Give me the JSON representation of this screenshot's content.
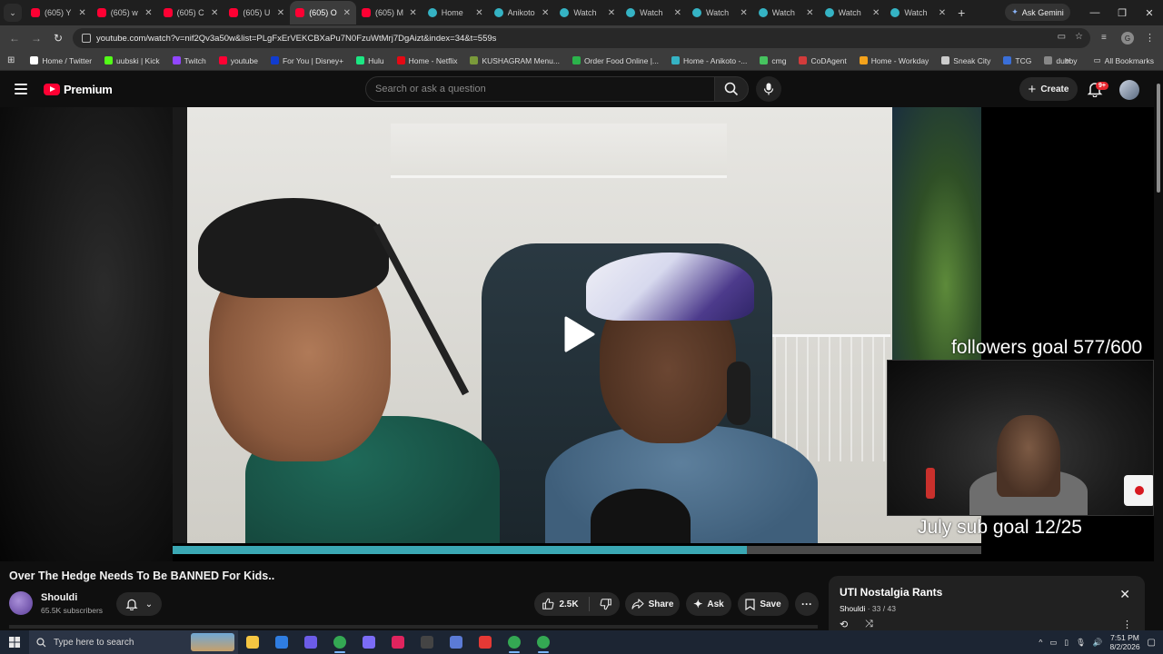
{
  "browser": {
    "tabs": [
      {
        "label": "(605) Y",
        "fav": "yt",
        "active": false
      },
      {
        "label": "(605) w",
        "fav": "yt",
        "active": false
      },
      {
        "label": "(605) C",
        "fav": "yt",
        "active": false
      },
      {
        "label": "(605) U",
        "fav": "yt",
        "active": false
      },
      {
        "label": "(605) O",
        "fav": "yt",
        "active": true
      },
      {
        "label": "(605) M",
        "fav": "yt",
        "active": false
      },
      {
        "label": "Home",
        "fav": "ani",
        "active": false
      },
      {
        "label": "Anikoto",
        "fav": "ani",
        "active": false
      },
      {
        "label": "Watch",
        "fav": "ani",
        "active": false
      },
      {
        "label": "Watch",
        "fav": "ani",
        "active": false
      },
      {
        "label": "Watch",
        "fav": "ani",
        "active": false
      },
      {
        "label": "Watch",
        "fav": "ani",
        "active": false
      },
      {
        "label": "Watch",
        "fav": "ani",
        "active": false
      },
      {
        "label": "Watch",
        "fav": "ani",
        "active": false
      }
    ],
    "ask_gemini": "Ask Gemini",
    "url": "youtube.com/watch?v=nif2Qv3a50w&list=PLgFxErVEKCBXaPu7N0FzuWtMrj7DgAizt&index=34&t=559s",
    "profile_initial": "G",
    "bookmarks": [
      {
        "label": "Home / Twitter",
        "color": "#ffffff"
      },
      {
        "label": "uubski | Kick",
        "color": "#53fc18"
      },
      {
        "label": "Twitch",
        "color": "#9146ff"
      },
      {
        "label": "youtube",
        "color": "#ff0033"
      },
      {
        "label": "For You | Disney+",
        "color": "#113ccf"
      },
      {
        "label": "Hulu",
        "color": "#1ce783"
      },
      {
        "label": "Home - Netflix",
        "color": "#e50914"
      },
      {
        "label": "KUSHAGRAM Menu...",
        "color": "#7a9a3a"
      },
      {
        "label": "Order Food Online |...",
        "color": "#2bb34b"
      },
      {
        "label": "Home - Anikoto -...",
        "color": "#35b3c4"
      },
      {
        "label": "cmg",
        "color": "#46c35f"
      },
      {
        "label": "CoDAgent",
        "color": "#d23b3b"
      },
      {
        "label": "Home - Workday",
        "color": "#f3a21b"
      },
      {
        "label": "Sneak City",
        "color": "#cccccc"
      },
      {
        "label": "TCG",
        "color": "#3a6fd8"
      },
      {
        "label": "dubby",
        "color": "#888888"
      }
    ],
    "all_bookmarks": "All Bookmarks"
  },
  "youtube": {
    "logo_text": "Premium",
    "search_placeholder": "Search or ask a question",
    "create_label": "Create",
    "notif_badge": "9+"
  },
  "video": {
    "progress": 0.71,
    "overlay_followers": "followers goal 577/600",
    "overlay_sub": "July sub goal 12/25",
    "title": "Over The Hedge Needs To Be BANNED For Kids..",
    "channel": "Shouldi",
    "subscribers": "65.5K subscribers",
    "likes": "2.5K",
    "share_label": "Share",
    "ask_label": "Ask",
    "save_label": "Save"
  },
  "playlist": {
    "title": "UTI Nostalgia Rants",
    "owner": "Shouldi",
    "position": "33 / 43"
  },
  "taskbar": {
    "search_placeholder": "Type here to search",
    "time": "7:51 PM",
    "date": "8/2/2026",
    "apps": [
      {
        "name": "file-explorer",
        "color": "#f4c542"
      },
      {
        "name": "app-blue",
        "color": "#2f7de1"
      },
      {
        "name": "discord",
        "color": "#6c5ce7"
      },
      {
        "name": "chrome",
        "color": "#34a853"
      },
      {
        "name": "game-controller",
        "color": "#7b6cf6"
      },
      {
        "name": "media-player",
        "color": "#e0245e"
      },
      {
        "name": "obs",
        "color": "#444444"
      },
      {
        "name": "app-circle",
        "color": "#5b7bd6"
      },
      {
        "name": "app-red",
        "color": "#e53935"
      },
      {
        "name": "chrome-2",
        "color": "#34a853"
      },
      {
        "name": "chrome-3",
        "color": "#34a853"
      }
    ]
  }
}
